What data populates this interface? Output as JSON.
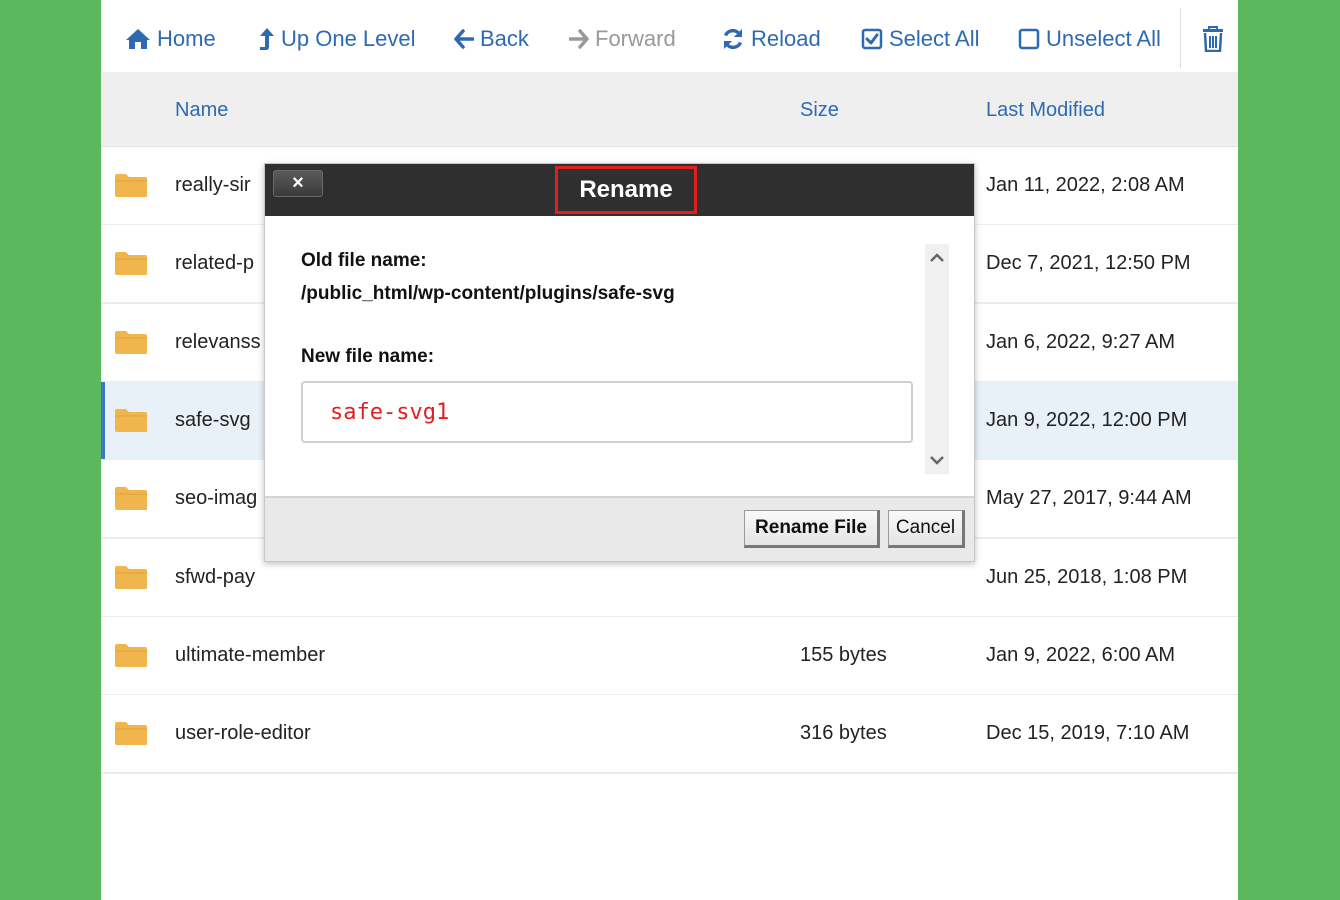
{
  "toolbar": {
    "home": "Home",
    "up_one_level": "Up One Level",
    "back": "Back",
    "forward": "Forward",
    "reload": "Reload",
    "select_all": "Select All",
    "unselect_all": "Unselect All",
    "delete_icon": "trash-icon"
  },
  "table": {
    "headers": {
      "name": "Name",
      "size": "Size",
      "modified": "Last Modified"
    },
    "rows": [
      {
        "name": "really-sir",
        "size": "",
        "modified": "Jan 11, 2022, 2:08 AM",
        "selected": false
      },
      {
        "name": "related-p",
        "size": "",
        "modified": "Dec 7, 2021, 12:50 PM",
        "selected": false
      },
      {
        "name": "relevanss",
        "size": "",
        "modified": "Jan 6, 2022, 9:27 AM",
        "selected": false
      },
      {
        "name": "safe-svg",
        "size": "",
        "modified": "Jan 9, 2022, 12:00 PM",
        "selected": true
      },
      {
        "name": "seo-imag",
        "size": "",
        "modified": "May 27, 2017, 9:44 AM",
        "selected": false
      },
      {
        "name": "sfwd-pay",
        "size": "",
        "modified": "Jun 25, 2018, 1:08 PM",
        "selected": false
      },
      {
        "name": "ultimate-member",
        "size": "155 bytes",
        "modified": "Jan 9, 2022, 6:00 AM",
        "selected": false
      },
      {
        "name": "user-role-editor",
        "size": "316 bytes",
        "modified": "Dec 15, 2019, 7:10 AM",
        "selected": false
      }
    ]
  },
  "modal": {
    "close_label": "×",
    "title": "Rename",
    "old_label": "Old file name:",
    "old_path": "/public_html/wp-content/plugins/safe-svg",
    "new_label": "New file name:",
    "new_value": "safe-svg1",
    "rename_button": "Rename File",
    "cancel_button": "Cancel"
  },
  "colors": {
    "page_background": "#5cb85c",
    "link_blue": "#2e6ab1",
    "folder": "#f0b54c",
    "highlight_red": "#e02020"
  }
}
